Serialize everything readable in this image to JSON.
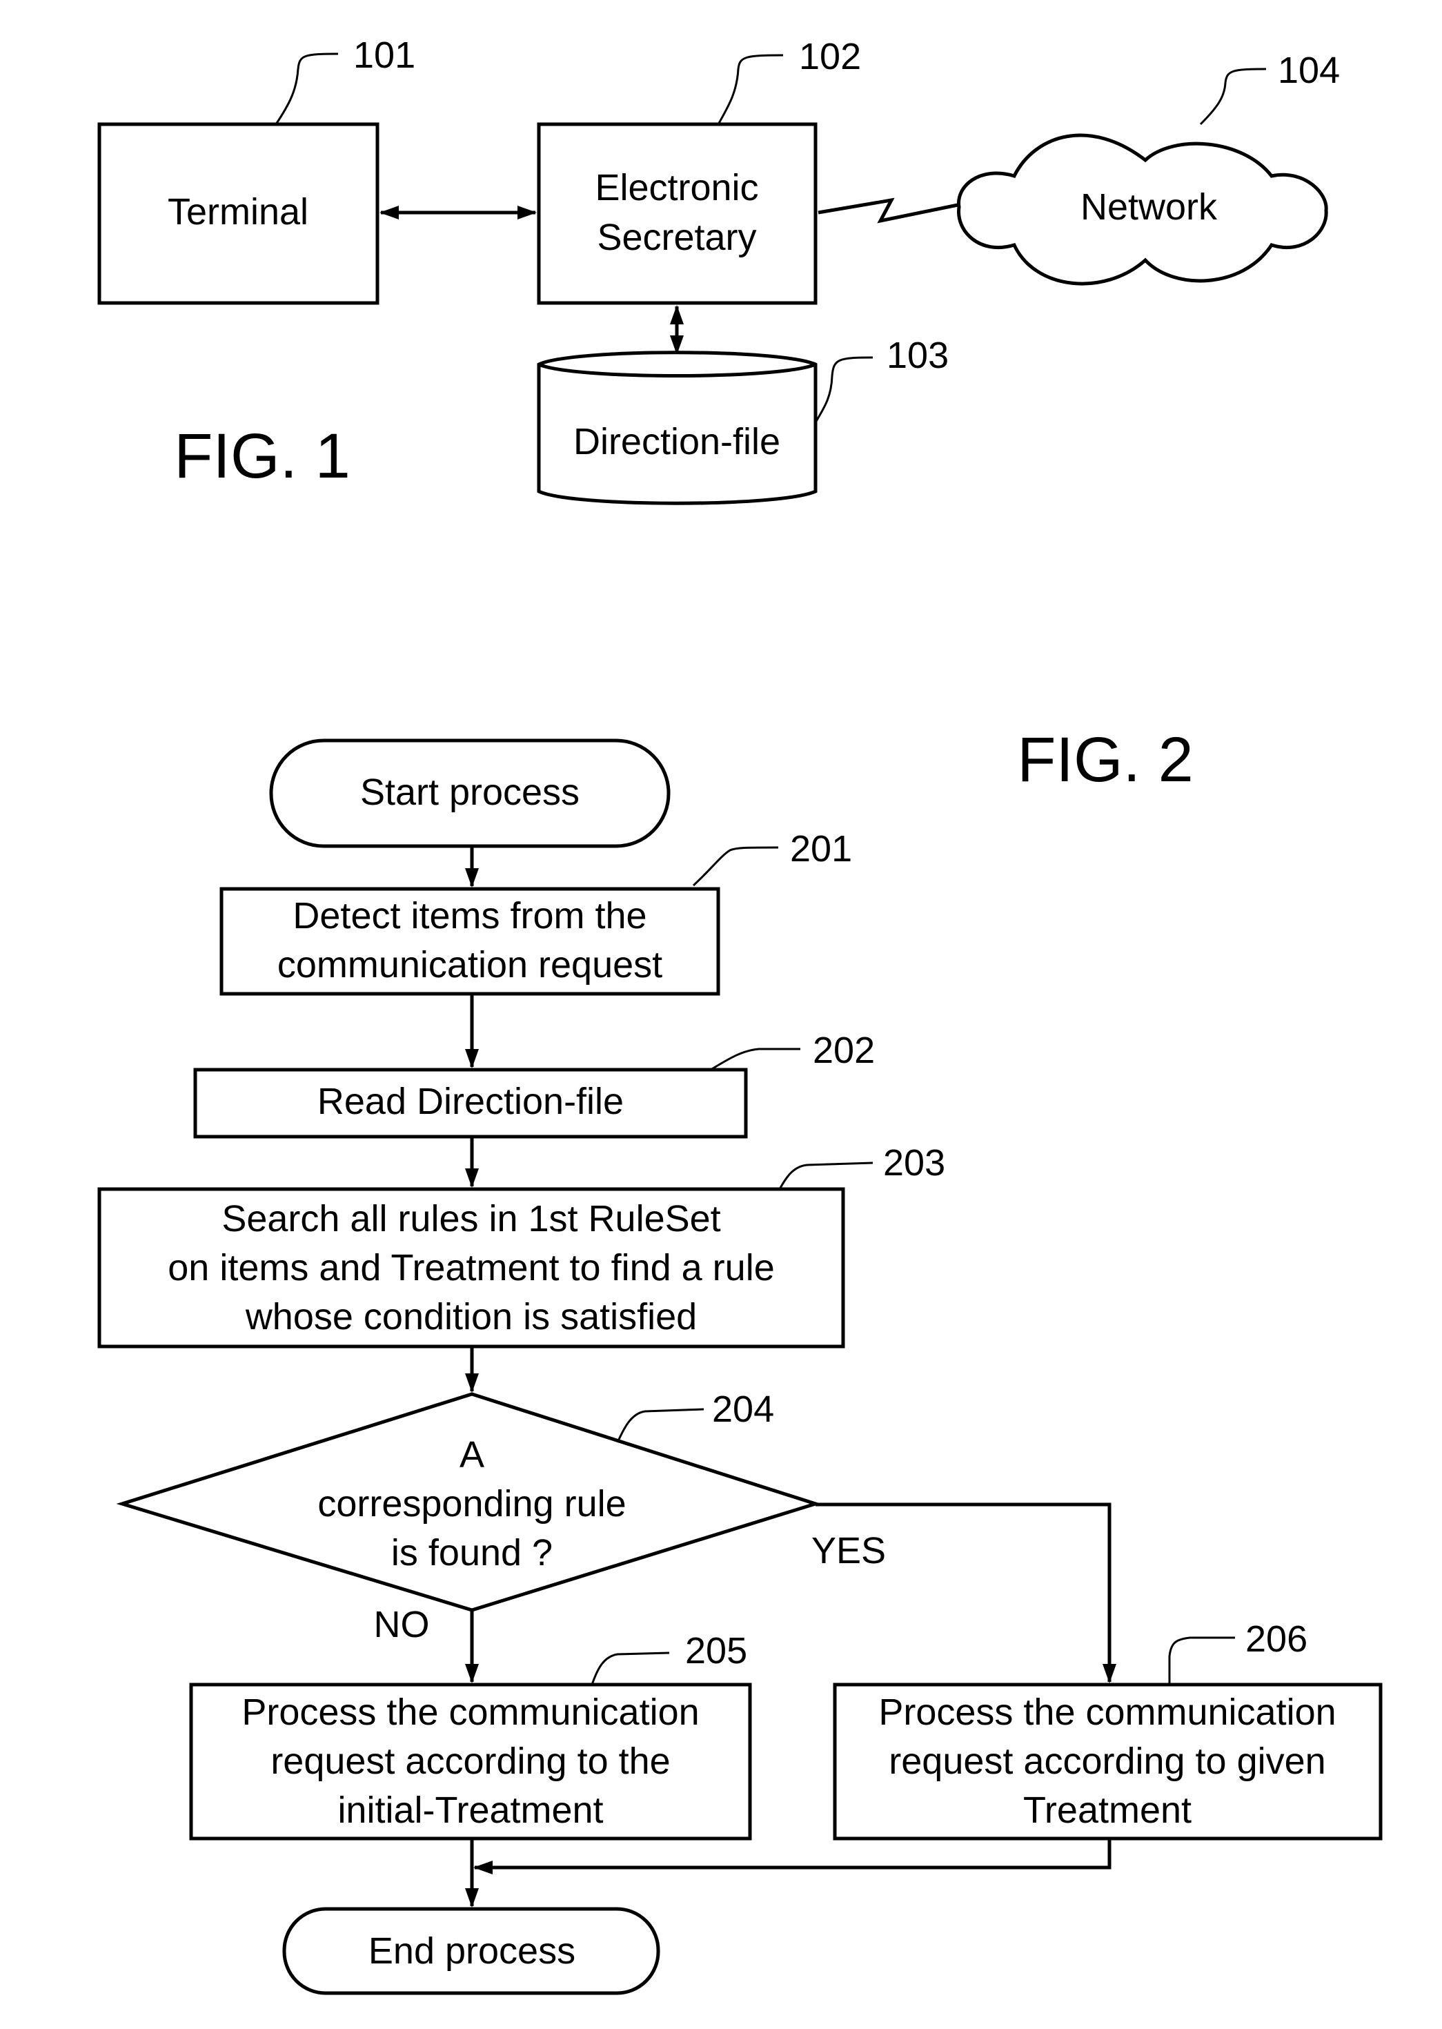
{
  "fig1": {
    "caption": "FIG. 1",
    "nodes": {
      "terminal": {
        "ref": "101",
        "label": "Terminal"
      },
      "secretary": {
        "ref": "102",
        "lines": [
          "Electronic",
          "Secretary"
        ]
      },
      "direction_file": {
        "ref": "103",
        "label": "Direction-file"
      },
      "network": {
        "ref": "104",
        "label": "Network"
      }
    },
    "connections": [
      {
        "from": "terminal",
        "to": "secretary",
        "type": "bidirectional-arrow"
      },
      {
        "from": "secretary",
        "to": "network",
        "type": "wireless-link"
      },
      {
        "from": "secretary",
        "to": "direction_file",
        "type": "bidirectional-arrow"
      }
    ]
  },
  "fig2": {
    "caption": "FIG. 2",
    "start": {
      "label": "Start process"
    },
    "step201": {
      "ref": "201",
      "lines": [
        "Detect items from the",
        "communication request"
      ]
    },
    "step202": {
      "ref": "202",
      "label": "Read Direction-file"
    },
    "step203": {
      "ref": "203",
      "lines": [
        "Search all rules in 1st RuleSet",
        "on items and Treatment to find a rule",
        "whose condition is satisfied"
      ]
    },
    "decision204": {
      "ref": "204",
      "lines": [
        "A",
        "corresponding rule",
        "is found ?"
      ],
      "yes_label": "YES",
      "no_label": "NO"
    },
    "step205": {
      "ref": "205",
      "lines": [
        "Process the communication",
        "request according to the",
        "initial-Treatment"
      ]
    },
    "step206": {
      "ref": "206",
      "lines": [
        "Process the communication",
        "request according to given",
        "Treatment"
      ]
    },
    "end": {
      "label": "End process"
    }
  }
}
